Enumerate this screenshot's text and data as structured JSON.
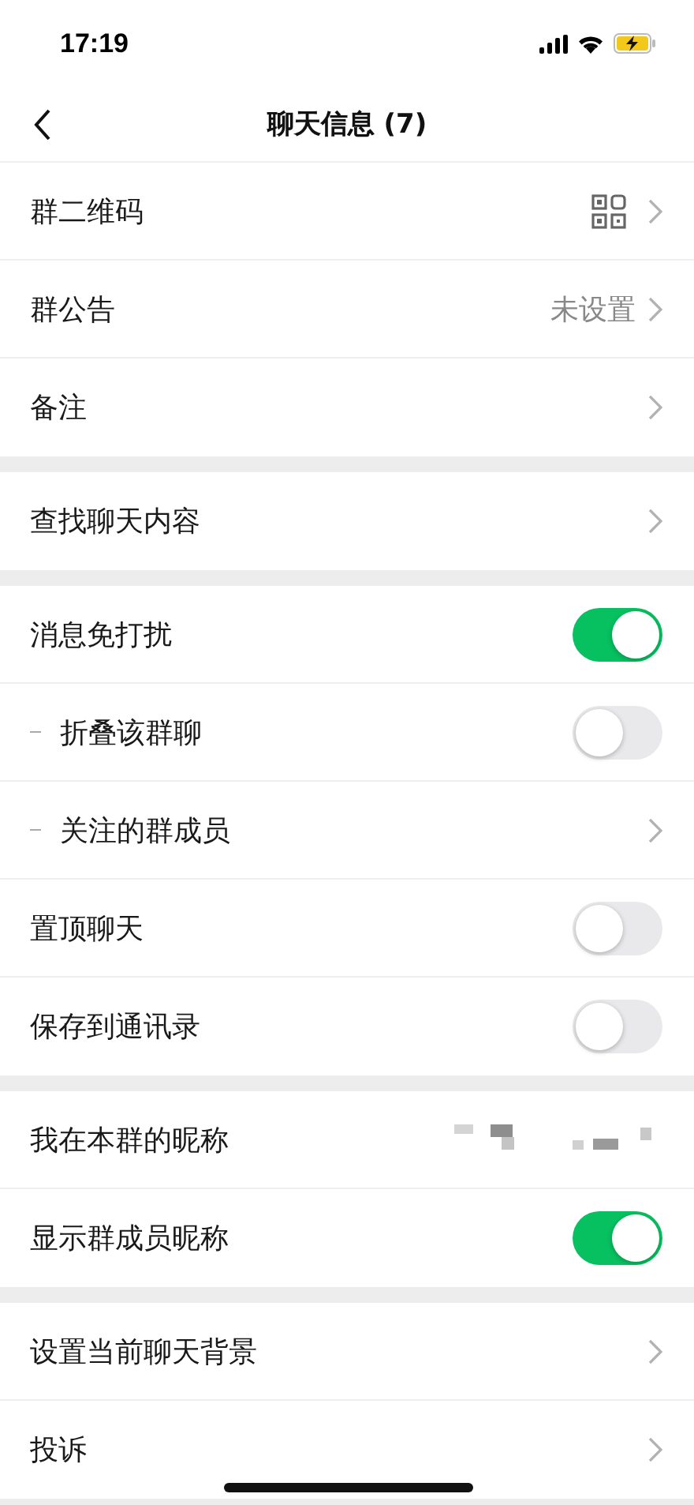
{
  "status_bar": {
    "time": "17:19"
  },
  "nav": {
    "title": "聊天信息 (7)"
  },
  "groups": [
    {
      "rows": [
        {
          "kind": "qr",
          "label": "群二维码",
          "indented": false
        },
        {
          "kind": "chevron",
          "label": "群公告",
          "value": "未设置",
          "indented": false
        },
        {
          "kind": "chevron",
          "label": "备注",
          "indented": false
        }
      ]
    },
    {
      "rows": [
        {
          "kind": "chevron",
          "label": "查找聊天内容",
          "indented": false
        }
      ]
    },
    {
      "rows": [
        {
          "kind": "toggle",
          "label": "消息免打扰",
          "on": true,
          "indented": false
        },
        {
          "kind": "toggle",
          "label": "折叠该群聊",
          "on": false,
          "indented": true
        },
        {
          "kind": "chevron",
          "label": "关注的群成员",
          "indented": true
        },
        {
          "kind": "toggle",
          "label": "置顶聊天",
          "on": false,
          "indented": false
        },
        {
          "kind": "toggle",
          "label": "保存到通讯录",
          "on": false,
          "indented": false
        }
      ]
    },
    {
      "rows": [
        {
          "kind": "blurred",
          "label": "我在本群的昵称",
          "indented": false
        },
        {
          "kind": "toggle",
          "label": "显示群成员昵称",
          "on": true,
          "indented": false
        }
      ]
    },
    {
      "rows": [
        {
          "kind": "chevron",
          "label": "设置当前聊天背景",
          "indented": false
        },
        {
          "kind": "chevron",
          "label": "投诉",
          "indented": false
        }
      ]
    }
  ]
}
